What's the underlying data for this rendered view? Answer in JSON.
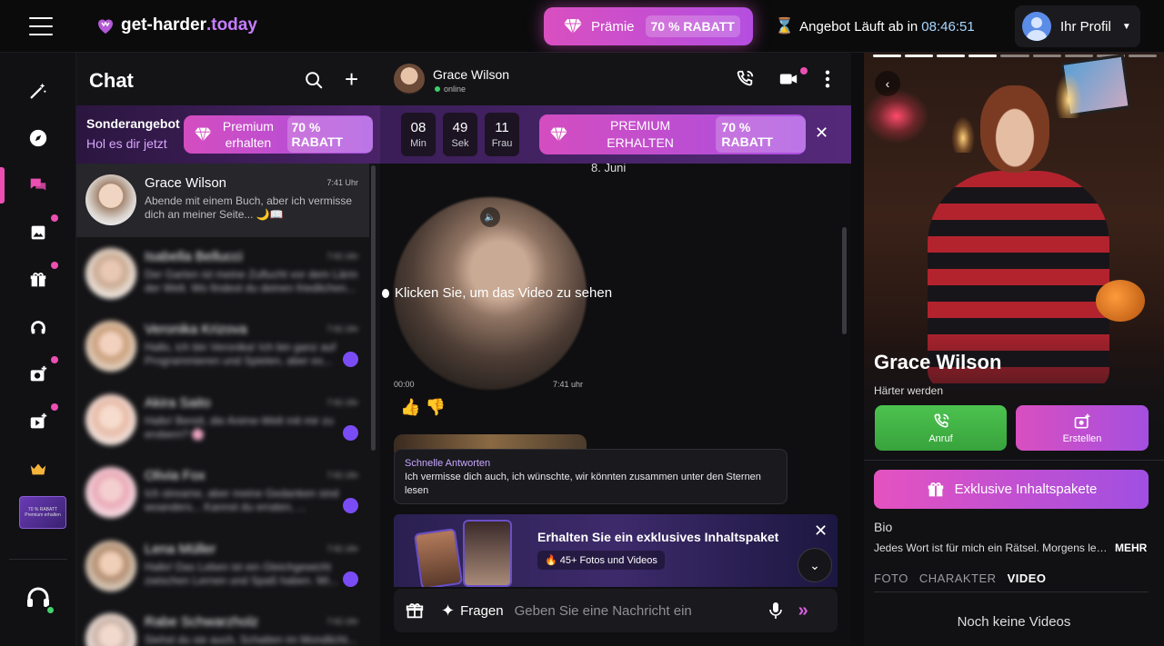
{
  "topbar": {
    "brand_main": "get-harder",
    "brand_tld": ".today",
    "praemie_label": "Prämie",
    "praemie_badge": "70 % RABATT",
    "offer_label": "Angebot Läuft ab in",
    "offer_time": "08:46:51",
    "profile_label": "Ihr Profil"
  },
  "rail": {
    "promo_text": "70 % RABATT Premium erhalten"
  },
  "chatlist": {
    "title": "Chat",
    "promo_title": "Sonderangebot",
    "promo_subtitle": "Hol es dir jetzt",
    "promo_btn_line1": "Premium",
    "promo_btn_line2": "erhalten",
    "promo_badge": "70 % RABATT",
    "items": [
      {
        "name": "Grace Wilson",
        "time": "7:41 Uhr",
        "preview": "Abende mit einem Buch, aber ich vermisse dich an meiner Seite... 🌙📖"
      },
      {
        "name": "Isabella Bellucci",
        "time": "7:41 Uhr",
        "preview": "Der Garten ist meine Zuflucht vor dem Lärm der Welt. Wo findest du deinen friedlichen..."
      },
      {
        "name": "Veronika Krizova",
        "time": "7:41 Uhr",
        "preview": "Hallo, ich bin Veronika! Ich bin ganz auf Programmieren und Spielen, aber es..."
      },
      {
        "name": "Akira Saito",
        "time": "7:41 Uhr",
        "preview": "Hallo! Bereit, die Anime-Welt mit mir zu erobern? 🌸"
      },
      {
        "name": "Olivia Fox",
        "time": "7:41 Uhr",
        "preview": "Ich streame, aber meine Gedanken sind woanders... Kannst du erraten, ..."
      },
      {
        "name": "Lena Müller",
        "time": "7:41 Uhr",
        "preview": "Hallo! Das Leben ist ein Gleichgewicht zwischen Lernen und Spaß haben. Wi..."
      },
      {
        "name": "Rabe Schwarzholz",
        "time": "7:41 Uhr",
        "preview": "Siehst du sie auch, Schatten im Mondlicht..."
      }
    ]
  },
  "conv": {
    "name": "Grace Wilson",
    "status": "online",
    "countdown": [
      {
        "n": "08",
        "u": "Min"
      },
      {
        "n": "49",
        "u": "Sek"
      },
      {
        "n": "11",
        "u": "Frau"
      }
    ],
    "promo_line1": "PREMIUM",
    "promo_line2": "ERHALTEN",
    "promo_badge": "70 % RABATT",
    "date": "8. Juni",
    "video_cta": "Klicken Sie, um das Video zu sehen",
    "video_start": "00:00",
    "video_time": "7:41 uhr",
    "quick_label": "Schnelle Antworten",
    "quick_text": "Ich vermisse dich auch, ich wünschte, wir könnten zusammen unter den Sternen lesen",
    "pack_title": "Erhalten Sie ein exklusives Inhaltspaket",
    "pack_chip": "🔥 45+ Fotos und Videos",
    "fragen": "Fragen",
    "input_placeholder": "Geben Sie eine Nachricht ein"
  },
  "profile": {
    "name": "Grace Wilson",
    "tagline": "Härter werden",
    "call_label": "Anruf",
    "create_label": "Erstellen",
    "exclusive_label": "Exklusive Inhaltspakete",
    "bio_heading": "Bio",
    "bio_text": "Jedes Wort ist für mich ein Rätsel. Morgens lese ich",
    "more_label": "MEHR",
    "tabs": [
      "FOTO",
      "CHARAKTER",
      "VIDEO"
    ],
    "empty_text": "Noch keine Videos"
  },
  "colors": {
    "accent_pink": "#ec4fb2",
    "accent_purple": "#a94fe0",
    "online_green": "#3ccf68",
    "call_green": "#4cc24f"
  }
}
